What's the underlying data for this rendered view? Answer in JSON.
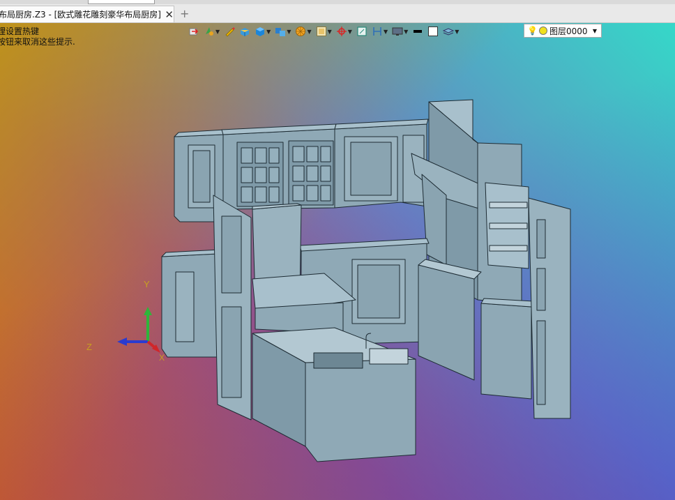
{
  "document_tab": {
    "title": "布局厨房.Z3 - [欧式雕花雕刻豪华布局厨房]",
    "close_icon": "close-icon"
  },
  "new_tab_label": "+",
  "hint": {
    "line1": "理设置热键",
    "line2": "按钮来取消这些提示."
  },
  "toolbar": {
    "icons": [
      "view-orient-icon",
      "display-mode-icon",
      "pencil-icon",
      "shaded-box-icon",
      "solid-box-icon",
      "component-icon",
      "section-icon",
      "zoom-fit-icon",
      "snap-icon",
      "frame-icon",
      "dimension-icon",
      "render-icon",
      "line-style-icon",
      "color-square-icon",
      "layers-icon"
    ],
    "layer": {
      "value": "图层0000"
    }
  },
  "axes": {
    "x": "X",
    "y": "Y",
    "z": "Z"
  },
  "colors": {
    "model_face": "#8fa9b6",
    "model_light": "#a8c0cc",
    "model_dark": "#6f8b99",
    "edge": "#1d2b33",
    "axis_y": "#2fb53a",
    "axis_z": "#2a3bd0",
    "axis_x": "#d0262a"
  }
}
